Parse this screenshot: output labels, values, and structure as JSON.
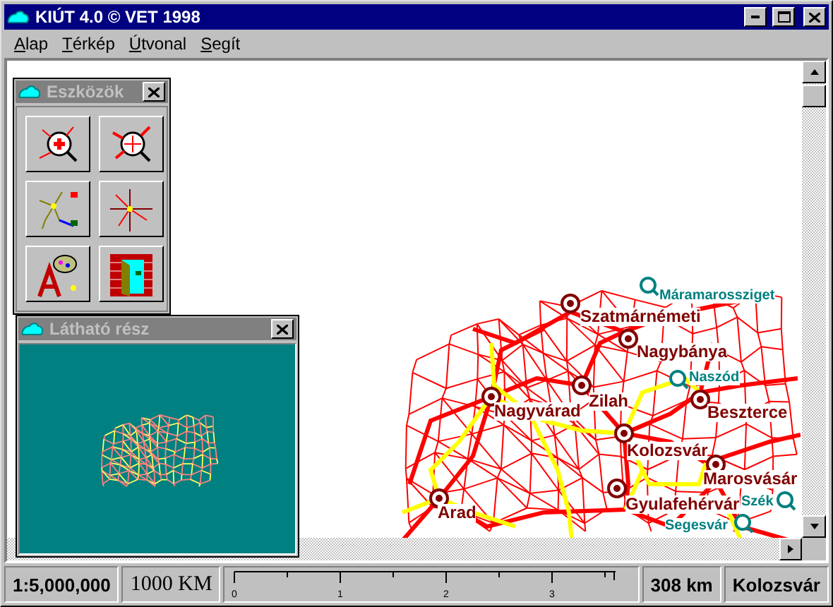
{
  "window": {
    "title": "KIÚT 4.0 © VET 1998"
  },
  "menu": [
    "Alap",
    "Térkép",
    "Útvonal",
    "Segít"
  ],
  "toolbox": {
    "title": "Eszközök"
  },
  "overview": {
    "title": "Látható rész"
  },
  "map": {
    "places": [
      {
        "name": "Máramarossziget",
        "kind": "town"
      },
      {
        "name": "Szatmárnémeti",
        "kind": "city"
      },
      {
        "name": "Nagybánya",
        "kind": "city"
      },
      {
        "name": "Naszód",
        "kind": "town"
      },
      {
        "name": "Zilah",
        "kind": "city"
      },
      {
        "name": "Nagyvárad",
        "kind": "city"
      },
      {
        "name": "Beszterce",
        "kind": "city"
      },
      {
        "name": "Kolozsvár",
        "kind": "city"
      },
      {
        "name": "Marosvásár",
        "kind": "city"
      },
      {
        "name": "Gyulafehérvár",
        "kind": "city"
      },
      {
        "name": "Szék",
        "kind": "town"
      },
      {
        "name": "Arad",
        "kind": "city"
      },
      {
        "name": "Segesvár",
        "kind": "town"
      }
    ]
  },
  "status_bar": {
    "scale": "1:5,000,000",
    "length": "1000 KM",
    "ruler_ticks": [
      "0",
      "1",
      "2",
      "3"
    ],
    "distance": "308 km",
    "place": "Kolozsvár"
  }
}
